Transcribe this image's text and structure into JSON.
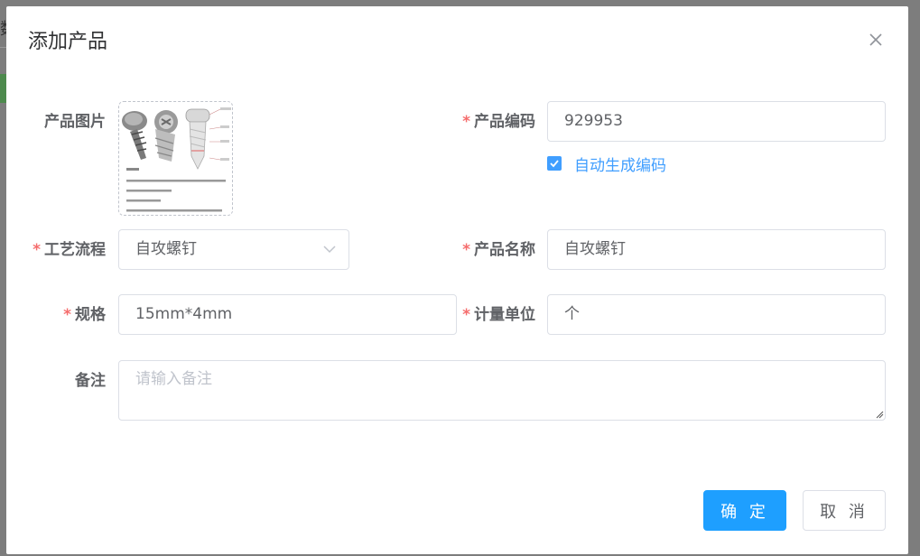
{
  "background": {
    "glyph": "数"
  },
  "dialog": {
    "title": "添加产品",
    "close_icon": "close-icon"
  },
  "form": {
    "image": {
      "label": "产品图片"
    },
    "code": {
      "label": "产品编码",
      "required": true,
      "value": "929953"
    },
    "auto_code": {
      "label": "自动生成编码",
      "checked": true
    },
    "process": {
      "label": "工艺流程",
      "required": true,
      "value": "自攻螺钉"
    },
    "name": {
      "label": "产品名称",
      "required": true,
      "value": "自攻螺钉"
    },
    "spec": {
      "label": "规格",
      "required": true,
      "value": "15mm*4mm"
    },
    "unit": {
      "label": "计量单位",
      "required": true,
      "value": "个"
    },
    "remark": {
      "label": "备注",
      "placeholder": "请输入备注",
      "value": ""
    }
  },
  "buttons": {
    "confirm": "确 定",
    "cancel": "取 消"
  },
  "colors": {
    "primary": "#1e9fff",
    "accent": "#409eff",
    "required": "#f56c6c"
  },
  "required_mark": "*"
}
